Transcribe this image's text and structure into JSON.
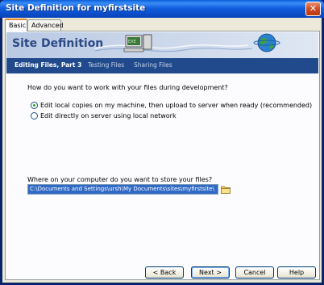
{
  "window": {
    "title": "Site Definition for myfirstsite",
    "close_glyph": "✕"
  },
  "tabs": [
    {
      "label": "Basic",
      "active": true
    },
    {
      "label": "Advanced",
      "active": false
    }
  ],
  "banner": {
    "title": "Site Definition"
  },
  "steps": [
    {
      "label": "Editing Files, Part 3",
      "current": true
    },
    {
      "label": "Testing Files",
      "current": false
    },
    {
      "label": "Sharing Files",
      "current": false
    }
  ],
  "question": "How do you want to work with your files during development?",
  "options": [
    {
      "label": "Edit local copies on my machine, then upload to server when ready (recommended)",
      "selected": true
    },
    {
      "label": "Edit directly on server using local network",
      "selected": false
    }
  ],
  "storage": {
    "label": "Where on your computer do you want to store your files?",
    "value": "C:\\Documents and Settings\\ursh\\My Documents\\sites\\myfirstsite\\"
  },
  "buttons": {
    "back": "< Back",
    "next": "Next >",
    "cancel": "Cancel",
    "help": "Help"
  },
  "icons": {
    "close": "close-icon",
    "computer": "computer-icon",
    "globe": "globe-icon",
    "folder": "folder-icon"
  },
  "colors": {
    "titlebar": "#0a5fd8",
    "step_bar": "#204a8c",
    "banner_title": "#2b4a86",
    "selection": "#316ac5"
  }
}
